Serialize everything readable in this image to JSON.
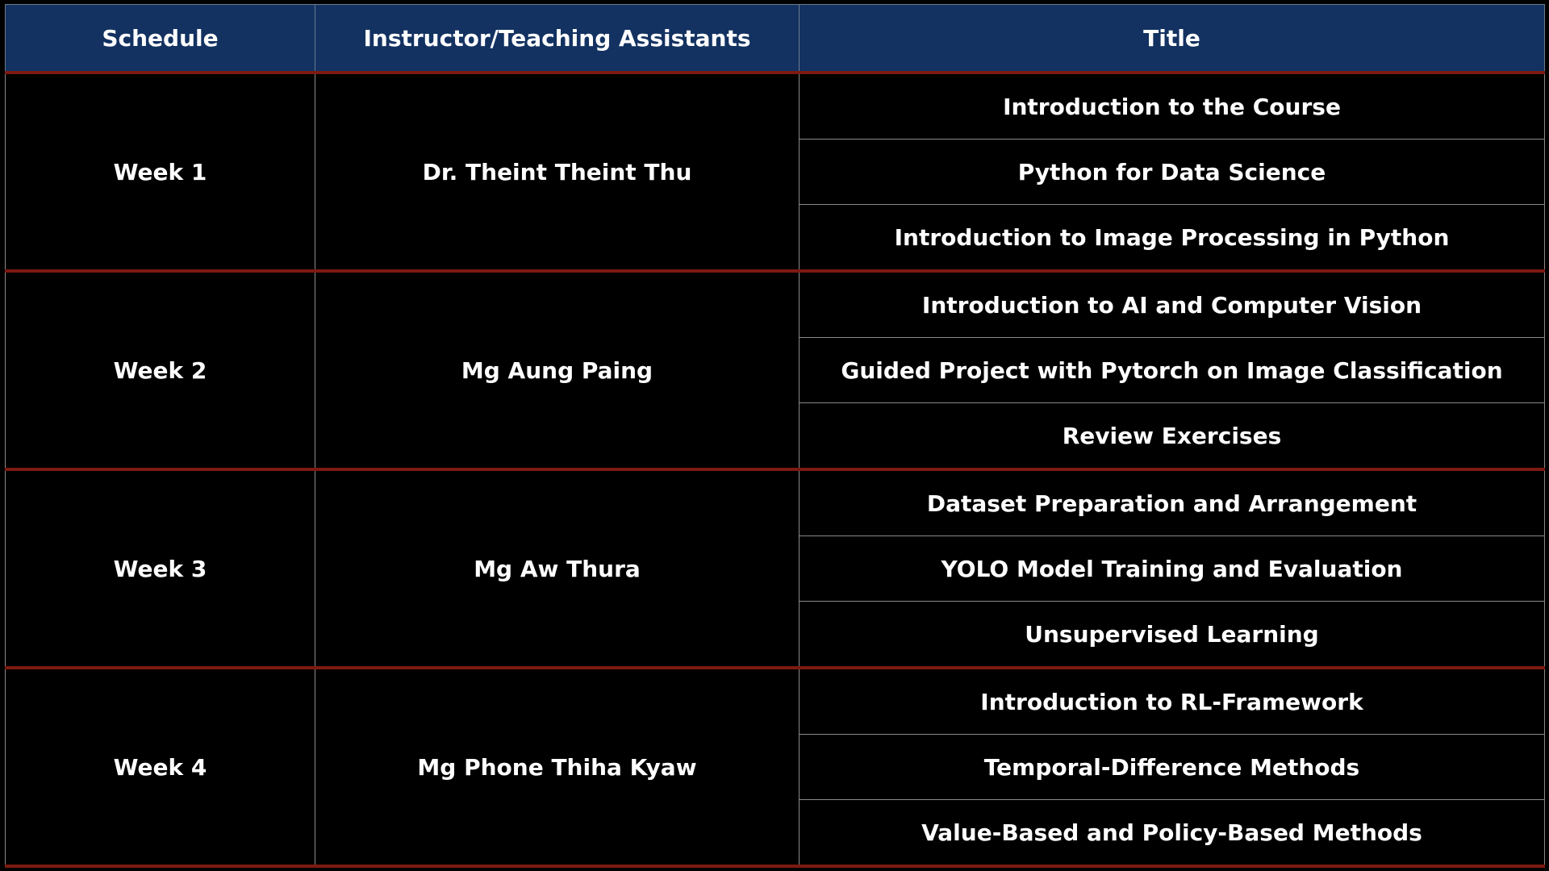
{
  "headers": {
    "schedule": "Schedule",
    "instructor": "Instructor/Teaching Assistants",
    "title": "Title"
  },
  "colors": {
    "header_background": "#133261",
    "body_background": "#000000",
    "week_separator": "#7d1a11",
    "text": "#ffffff"
  },
  "weeks": [
    {
      "week": "Week 1",
      "instructor": "Dr. Theint Theint Thu",
      "titles": [
        "Introduction to the Course",
        "Python for Data Science",
        "Introduction to Image Processing in Python"
      ]
    },
    {
      "week": "Week 2",
      "instructor": "Mg Aung Paing",
      "titles": [
        "Introduction to AI and Computer Vision",
        "Guided Project with Pytorch on Image Classification",
        "Review Exercises"
      ]
    },
    {
      "week": "Week 3",
      "instructor": "Mg Aw Thura",
      "titles": [
        "Dataset Preparation and Arrangement",
        "YOLO Model Training and Evaluation",
        "Unsupervised Learning"
      ]
    },
    {
      "week": "Week 4",
      "instructor": "Mg Phone Thiha Kyaw",
      "titles": [
        "Introduction to RL-Framework",
        "Temporal-Difference Methods",
        "Value-Based and Policy-Based Methods"
      ]
    }
  ]
}
